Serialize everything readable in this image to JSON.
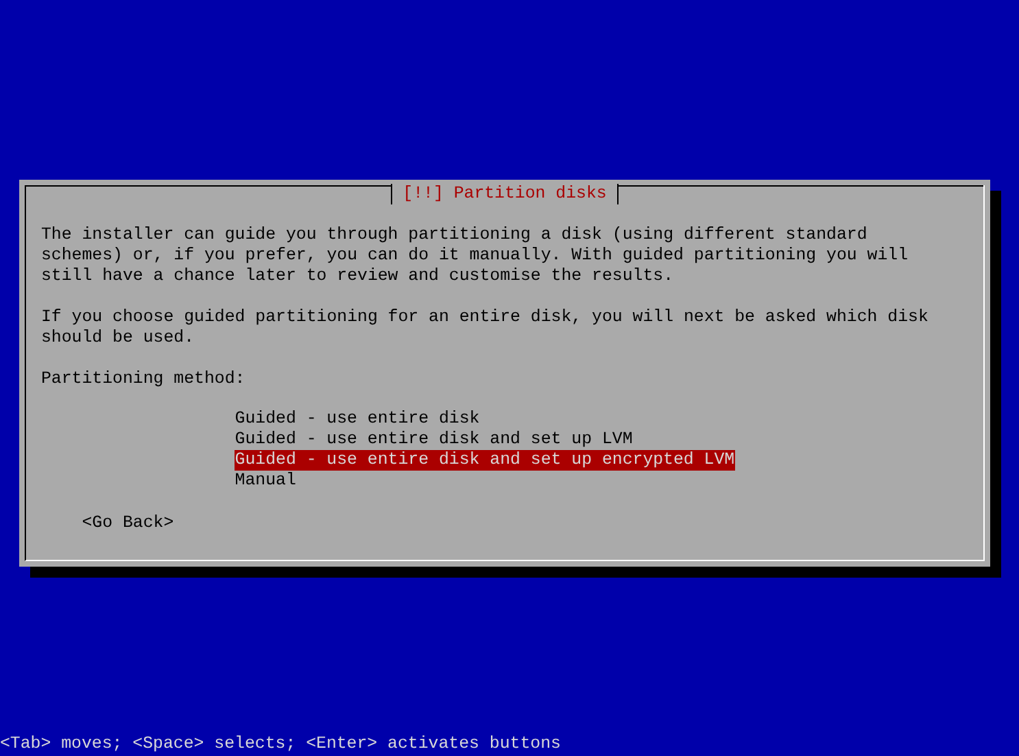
{
  "dialog": {
    "title": "[!!] Partition disks",
    "paragraphs": [
      "The installer can guide you through partitioning a disk (using different standard schemes) or, if you prefer, you can do it manually. With guided partitioning you will still have a chance later to review and customise the results.",
      "If you choose guided partitioning for an entire disk, you will next be asked which disk should be used."
    ],
    "prompt": "Partitioning method:",
    "options": [
      {
        "label": "Guided - use entire disk",
        "selected": false
      },
      {
        "label": "Guided - use entire disk and set up LVM",
        "selected": false
      },
      {
        "label": "Guided - use entire disk and set up encrypted LVM",
        "selected": true
      },
      {
        "label": "Manual",
        "selected": false
      }
    ],
    "buttons": [
      {
        "label": "<Go Back>"
      }
    ]
  },
  "status_bar": "<Tab> moves; <Space> selects; <Enter> activates buttons"
}
